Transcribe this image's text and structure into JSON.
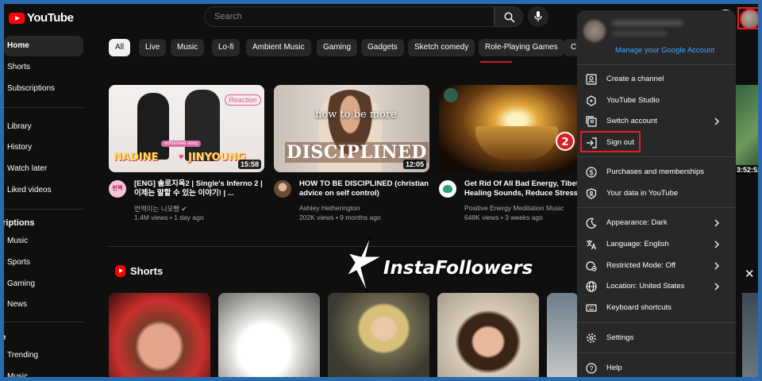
{
  "header": {
    "logo_text": "YouTube",
    "search_placeholder": "Search"
  },
  "sidebar": {
    "items": [
      {
        "label": "Home",
        "active": true
      },
      {
        "label": "Shorts"
      },
      {
        "label": "Subscriptions"
      },
      {
        "label": "Library"
      },
      {
        "label": "History"
      },
      {
        "label": "Watch later"
      },
      {
        "label": "Liked videos"
      }
    ],
    "subscriptions_heading": "criptions",
    "subscriptions": [
      "Music",
      "Sports",
      "Gaming",
      "News"
    ],
    "explore_heading": "re",
    "explore": [
      "Trending",
      "Music"
    ]
  },
  "chips": [
    "All",
    "Live",
    "Music",
    "Lo-fi",
    "Ambient Music",
    "Gaming",
    "Gadgets",
    "Sketch comedy",
    "Role-Playing Games",
    "C"
  ],
  "videos": [
    {
      "title": "[ENG] 솔로지옥2 | Single's Inferno 2 | 이제는 말할 수 있는 이야기! | ...",
      "channel": "번쩍이는 니모뻥",
      "meta": "1.4M views • 1 day ago",
      "duration": "15:58",
      "thumb_text_left": "NADINE",
      "thumb_text_right": "JINYOUNG",
      "thumb_badge": "Reaction",
      "thumb_ribbon": "unfinished story",
      "avatar_text": "번쩍"
    },
    {
      "title": "HOW TO BE DISCIPLINED (christian advice on self control)",
      "channel": "Ashley Hetherington",
      "meta": "202K views • 9 months ago",
      "duration": "12:05",
      "thumb_text_small": "how to be more",
      "thumb_text_big": "DISCIPLINED"
    },
    {
      "title": "Get Rid Of All Bad Energy, Tibetan Healing Sounds, Reduce Stress A",
      "channel": "Positive Energy Meditation Music",
      "meta": "648K views • 3 weeks ago",
      "duration": "6:"
    }
  ],
  "right_video_duration": "3:52:52",
  "shorts": {
    "title": "Shorts"
  },
  "watermark": {
    "text": "InstaFollowers"
  },
  "account_menu": {
    "manage_label": "Manage your Google Account",
    "groups": [
      [
        {
          "label": "Create a channel",
          "icon": "person-square-icon"
        },
        {
          "label": "YouTube Studio",
          "icon": "studio-icon"
        },
        {
          "label": "Switch account",
          "icon": "switch-account-icon",
          "chevron": true
        },
        {
          "label": "Sign out",
          "icon": "sign-out-icon"
        }
      ],
      [
        {
          "label": "Purchases and memberships",
          "icon": "dollar-icon"
        },
        {
          "label": "Your data in YouTube",
          "icon": "shield-person-icon"
        }
      ],
      [
        {
          "label": "Appearance: Dark",
          "icon": "moon-icon",
          "chevron": true
        },
        {
          "label": "Language: English",
          "icon": "translate-icon",
          "chevron": true
        },
        {
          "label": "Restricted Mode: Off",
          "icon": "restricted-icon",
          "chevron": true
        },
        {
          "label": "Location: United States",
          "icon": "globe-icon",
          "chevron": true
        },
        {
          "label": "Keyboard shortcuts",
          "icon": "keyboard-icon"
        }
      ],
      [
        {
          "label": "Settings",
          "icon": "gear-icon"
        }
      ],
      [
        {
          "label": "Help",
          "icon": "help-icon"
        }
      ]
    ]
  },
  "callouts": [
    "1",
    "2"
  ],
  "colors": {
    "accent_red": "#e41e26",
    "link_blue": "#3ea6ff",
    "frame_blue": "#2a6bb0",
    "menu_bg": "#282828"
  }
}
